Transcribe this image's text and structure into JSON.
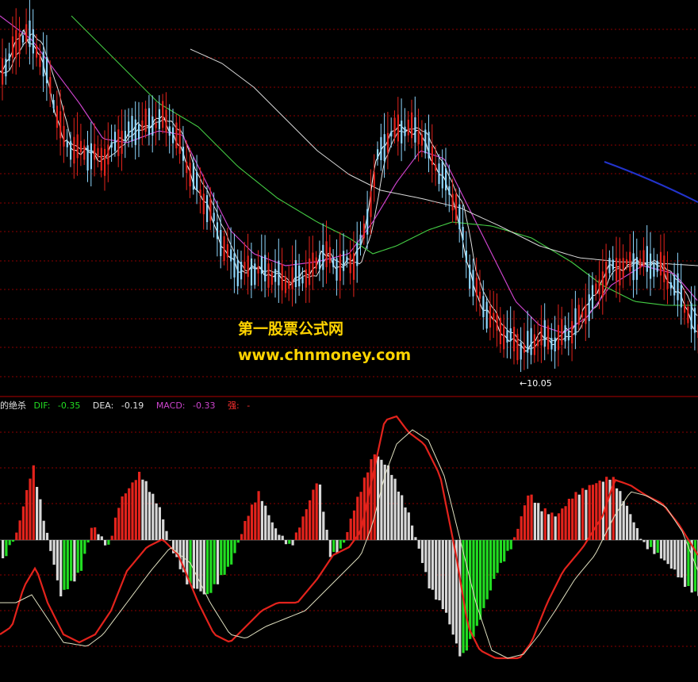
{
  "indicator": {
    "name_fragment": "的绝杀",
    "dif_label": "DIF:",
    "dif_value": "-0.35",
    "dea_label": "DEA:",
    "dea_value": "-0.19",
    "macd_label": "MACD:",
    "macd_value": "-0.33",
    "strength_label": "强:",
    "strength_value": "-"
  },
  "watermark": {
    "line1": "第一股票公式网",
    "line2": "www.chnmoney.com"
  },
  "price_low_annotation": "←10.05",
  "colors": {
    "background": "#000000",
    "up": "#e3231c",
    "down": "#8fd8ff",
    "ma5": "#ffffff",
    "ma10": "#e0e0e0",
    "ma20": "#cc44cc",
    "ma60": "#44cc44",
    "ma120": "#d8d8d8",
    "ma250": "#2233cc",
    "gridline": "#8b0000",
    "dif": "#e3231c",
    "dea": "#e0e0c0",
    "hist_pos": "#e3231c",
    "hist_neg_green": "#22dd22",
    "hist_gray": "#d8d8d8",
    "separator": "#b00000"
  },
  "chart_data": [
    {
      "type": "candlestick",
      "panel": "price",
      "lowest_price": 10.05,
      "ma_lines": [
        "ma5",
        "ma10",
        "ma20",
        "ma60",
        "ma120",
        "ma250"
      ]
    },
    {
      "type": "bar",
      "panel": "MACD",
      "series": [
        {
          "name": "DIF",
          "value": -0.35
        },
        {
          "name": "DEA",
          "value": -0.19
        },
        {
          "name": "MACD",
          "value": -0.33
        }
      ]
    }
  ]
}
